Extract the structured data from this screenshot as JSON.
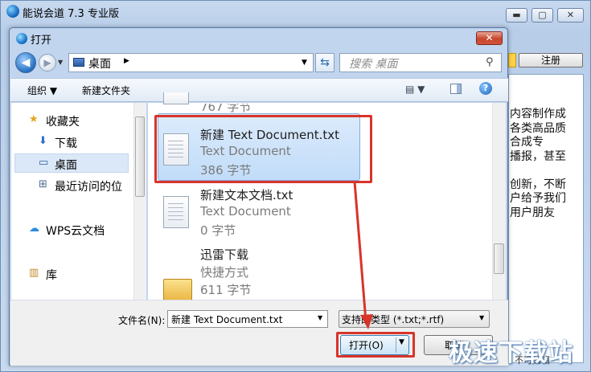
{
  "app": {
    "title": "能说会道 7.3 专业版",
    "caption_min": "▬",
    "caption_max": "▢",
    "caption_close": "✕",
    "register_label": "注册",
    "content_text": "内容制作成\n各类高品质\n合成专\n播报，甚至\n\n创新，不断\n户给予我们\n用户朋友",
    "status_right": "不可编辑"
  },
  "dialog": {
    "title": "打开",
    "close_glyph": "✕",
    "back_glyph": "◀",
    "forward_glyph": "▶",
    "history_glyph": "▼",
    "address": {
      "location": "桌面",
      "separator": "▶",
      "dropdown": "▼"
    },
    "refresh_glyph": "⇆",
    "search": {
      "placeholder": "搜索 桌面",
      "icon": "search-icon",
      "glyph": "⚲"
    },
    "toolbar": {
      "organize": "组织 ▼",
      "new_folder": "新建文件夹",
      "view": "▤ ▼",
      "help": "?"
    },
    "nav": {
      "items": [
        {
          "label": "收藏夹",
          "icon": "star-icon",
          "glyph": "★"
        },
        {
          "label": "下载",
          "icon": "download-folder-icon",
          "glyph": "⬇"
        },
        {
          "label": "桌面",
          "icon": "desktop-icon",
          "glyph": "▭"
        },
        {
          "label": "最近访问的位",
          "icon": "recent-places-icon",
          "glyph": "⊞"
        },
        {
          "label": "WPS云文档",
          "icon": "cloud-icon",
          "glyph": "☁"
        },
        {
          "label": "库",
          "icon": "library-icon",
          "glyph": "▥"
        }
      ]
    },
    "files": [
      {
        "name": "",
        "type": "",
        "size": "767 字节"
      },
      {
        "name": "新建 Text Document.txt",
        "type": "Text Document",
        "size": "386 字节"
      },
      {
        "name": "新建文本文档.txt",
        "type": "Text Document",
        "size": "0 字节"
      },
      {
        "name": "迅雷下载",
        "type": "快捷方式",
        "size": "611 字节"
      }
    ],
    "bottom": {
      "filename_label": "文件名(N):",
      "filename_value": "新建 Text Document.txt",
      "filetype_value": "支持的类型 (*.txt;*.rtf)",
      "dropdown": "▼",
      "open_label": "打开(O)",
      "open_arrow": "▼",
      "cancel_label": "取消"
    }
  },
  "watermark": "极速下载站",
  "colors": {
    "annotation_red": "#d8342a",
    "selection_blue": "#c1dcf9",
    "titlebar_blue": "#c1d5ee"
  }
}
